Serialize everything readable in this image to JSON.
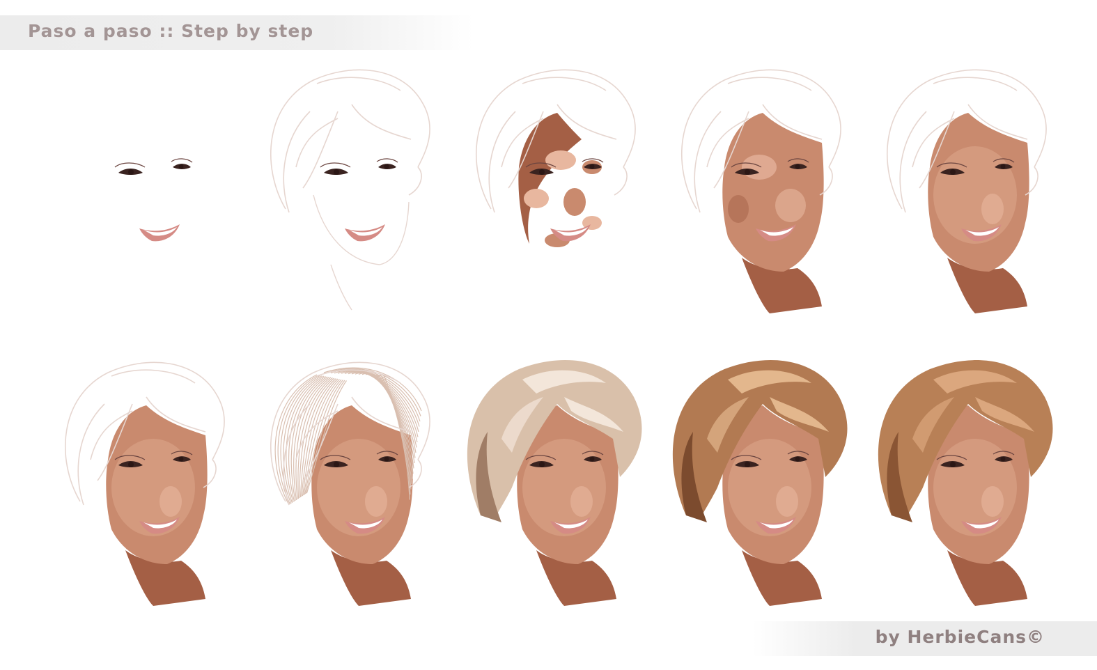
{
  "header": {
    "title": "Paso a paso :: Step by step"
  },
  "footer": {
    "credit": "by HerbieCans©"
  },
  "colors": {
    "skin": "#c98a6e",
    "skin_dark": "#a45f45",
    "skin_light": "#e8b79f",
    "hair": "#b27a52",
    "hair_light": "#e3b78d",
    "lips": "#d58b85",
    "sketch_line": "#e6d6d0"
  },
  "steps": [
    {
      "stage": 1,
      "hair": "none",
      "face": "none",
      "neck": false
    },
    {
      "stage": 2,
      "hair": "sketch",
      "face": "sketch",
      "neck": false
    },
    {
      "stage": 3,
      "hair": "sketch",
      "face": "patches",
      "neck": false
    },
    {
      "stage": 4,
      "hair": "sketch",
      "face": "blocked",
      "neck": true
    },
    {
      "stage": 5,
      "hair": "sketch",
      "face": "blended",
      "neck": true
    },
    {
      "stage": 6,
      "hair": "sketch",
      "face": "blended",
      "neck": true
    },
    {
      "stage": 7,
      "hair": "strands",
      "face": "blended",
      "neck": true
    },
    {
      "stage": 8,
      "hair": "blonde",
      "face": "blended",
      "neck": true
    },
    {
      "stage": 9,
      "hair": "brown",
      "face": "blended",
      "neck": true
    },
    {
      "stage": 10,
      "hair": "brown-smooth",
      "face": "blended",
      "neck": true
    }
  ]
}
